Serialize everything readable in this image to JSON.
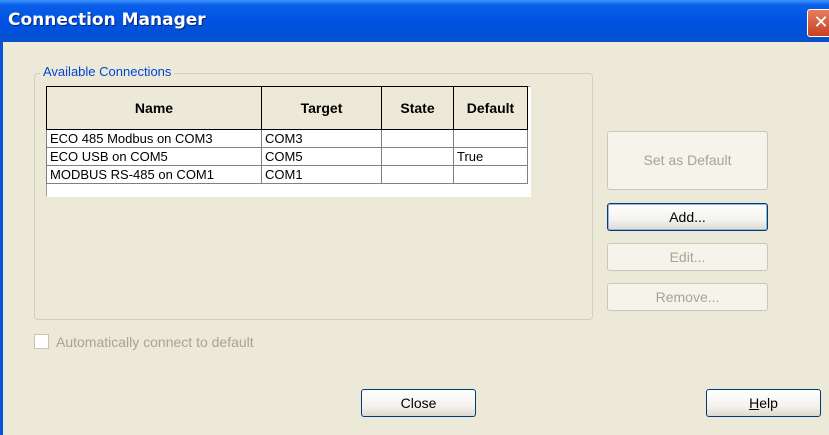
{
  "window": {
    "title": "Connection Manager",
    "close_glyph": "✕"
  },
  "group": {
    "label": "Available Connections"
  },
  "table": {
    "headers": {
      "name": "Name",
      "target": "Target",
      "state": "State",
      "default": "Default"
    },
    "rows": [
      {
        "name": "ECO 485 Modbus on COM3",
        "target": "COM3",
        "state": "",
        "default": ""
      },
      {
        "name": "ECO USB on COM5",
        "target": "COM5",
        "state": "",
        "default": "True"
      },
      {
        "name": "MODBUS RS-485 on COM1",
        "target": "COM1",
        "state": "",
        "default": ""
      }
    ]
  },
  "buttons": {
    "set_default": "Set as Default",
    "add": "Add...",
    "edit": "Edit...",
    "remove": "Remove...",
    "close": "Close",
    "help_mnemonic": "H",
    "help_rest": "elp"
  },
  "auto_connect": {
    "label": "Automatically connect to default",
    "checked": false,
    "enabled": false
  }
}
